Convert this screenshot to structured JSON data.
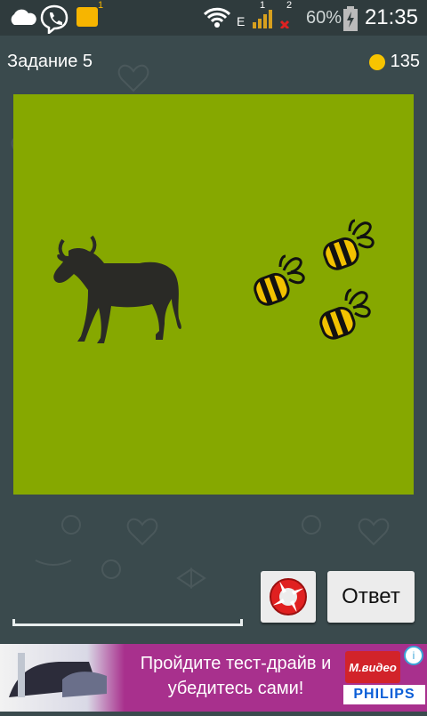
{
  "status_bar": {
    "time": "21:35",
    "battery_percent": "60%",
    "network": "E",
    "sim1": "1",
    "sim2": "2",
    "notification_count": "1",
    "icons": [
      "cloud-icon",
      "viber-icon",
      "message-icon",
      "wifi-icon",
      "signal-sim1-icon",
      "signal-sim2-icon",
      "battery-charging-icon"
    ]
  },
  "header": {
    "task_title": "Задание 5",
    "coins": "135"
  },
  "puzzle": {
    "background_color": "#86a800",
    "items": [
      "cow-icon",
      "bee-icon",
      "bee-icon",
      "bee-icon"
    ]
  },
  "buttons": {
    "hint_icon": "lifebuoy-icon",
    "answer_label": "Ответ"
  },
  "ad": {
    "text": "Пройдите тест-драйв и убедитесь сами!",
    "brand_top": "М.видео",
    "brand_bottom": "PHILIPS",
    "adchoices": "i"
  },
  "colors": {
    "background": "#3a4a4d",
    "status_bar": "#2f3b3d",
    "coin": "#f7c400",
    "ad": "#a8308d"
  }
}
